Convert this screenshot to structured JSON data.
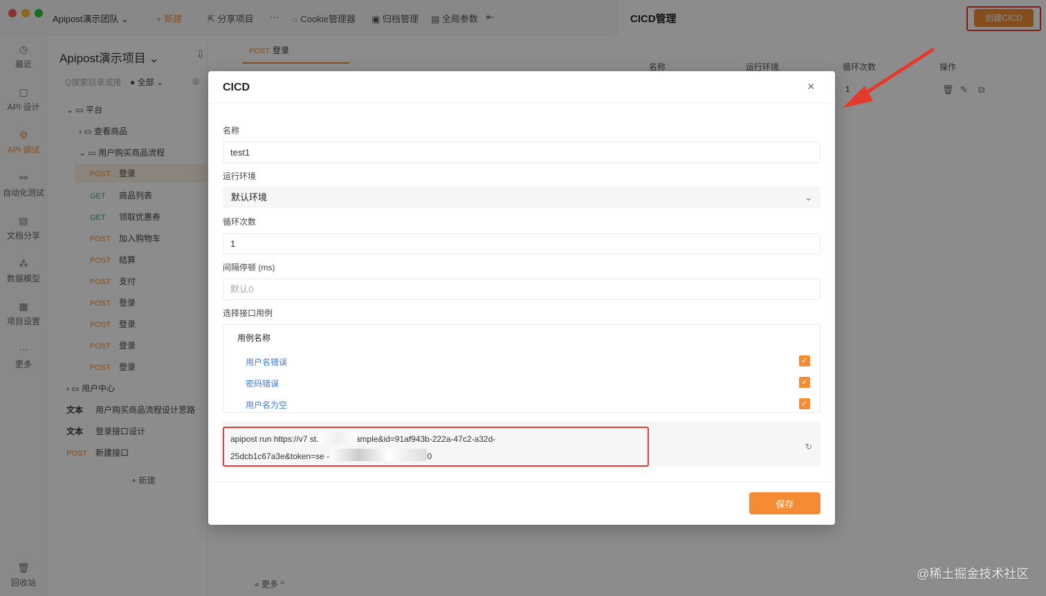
{
  "titlebar": {
    "team": "Apipost演示团队",
    "new": "+ 新建",
    "share": "分享项目",
    "more": "···",
    "cookie": "Cookie管理器",
    "archive": "归档管理",
    "global": "全局参数"
  },
  "leftnav": [
    {
      "label": "最近",
      "icon": "clock-icon"
    },
    {
      "label": "API 设计",
      "icon": "design-icon"
    },
    {
      "label": "API 调试",
      "icon": "debug-icon"
    },
    {
      "label": "自动化测试",
      "icon": "automation-icon"
    },
    {
      "label": "文档分享",
      "icon": "document-icon"
    },
    {
      "label": "数据模型",
      "icon": "model-icon"
    },
    {
      "label": "项目设置",
      "icon": "settings-icon"
    },
    {
      "label": "更多",
      "icon": "more-icon"
    },
    {
      "label": "回收站",
      "icon": "trash-icon"
    }
  ],
  "tree": {
    "project": "Apipost演示项目",
    "search_placeholder": "Q搜索目录或接",
    "filter": "● 全部",
    "new": "+ 新建",
    "rows": [
      {
        "method": "",
        "label": "平台",
        "kind": "folder"
      },
      {
        "method": "",
        "label": "查看商品",
        "kind": "folder"
      },
      {
        "method": "",
        "label": "用户购买商品流程",
        "kind": "folder"
      },
      {
        "method": "POST",
        "label": "登录"
      },
      {
        "method": "GET",
        "label": "商品列表"
      },
      {
        "method": "GET",
        "label": "领取优惠券"
      },
      {
        "method": "POST",
        "label": "加入购物车"
      },
      {
        "method": "POST",
        "label": "结算"
      },
      {
        "method": "POST",
        "label": "支付"
      },
      {
        "method": "POST",
        "label": "登录"
      },
      {
        "method": "POST",
        "label": "登录"
      },
      {
        "method": "POST",
        "label": "登录"
      },
      {
        "method": "POST",
        "label": "登录"
      },
      {
        "method": "",
        "label": "用户中心",
        "kind": "folder"
      },
      {
        "method": "文本",
        "label": "用户购买商品流程设计思路"
      },
      {
        "method": "文本",
        "label": "登录接口设计"
      },
      {
        "method": "POST",
        "label": "新建接口"
      }
    ]
  },
  "tab": {
    "method": "POST",
    "label": "登录"
  },
  "bottom_more": "« 更多 ^",
  "drawer": {
    "title": "CICD管理",
    "create": "创建CICD",
    "columns": [
      "名称",
      "运行环境",
      "循环次数",
      "操作"
    ],
    "row_loop": "1"
  },
  "modal": {
    "title": "CICD",
    "close": "×",
    "name_label": "名称",
    "name_value": "test1",
    "env_label": "运行环境",
    "env_value": "默认环境",
    "loop_label": "循环次数",
    "loop_value": "1",
    "delay_label": "间隔停顿 (ms)",
    "delay_placeholder": "默认0",
    "cases_label": "选择接口用例",
    "cases_header": "用例名称",
    "cases": [
      "用户名错误",
      "密码错误",
      "用户名为空"
    ],
    "command_line1": "apipost run https://v7 st.cn/api/cli/ ample&id=91af943b-222a-47c2-a32d-",
    "command_line2": "25dcb1c67a3e&token=se -r html -n 1 --delay-request 0",
    "save": "保存"
  },
  "watermark": "@稀土掘金技术社区",
  "colors": {
    "accent": "#f58c33",
    "highlight": "#e53a2b",
    "link": "#3a7bd5"
  }
}
